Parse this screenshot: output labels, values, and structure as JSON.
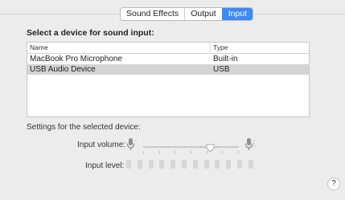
{
  "tabs": [
    {
      "label": "Sound Effects",
      "active": false
    },
    {
      "label": "Output",
      "active": false
    },
    {
      "label": "Input",
      "active": true
    }
  ],
  "section_title": "Select a device for sound input:",
  "table": {
    "columns": [
      "Name",
      "Type"
    ],
    "rows": [
      {
        "name": "MacBook Pro Microphone",
        "type": "Built-in",
        "selected": false
      },
      {
        "name": "USB Audio Device",
        "type": "USB",
        "selected": true
      }
    ]
  },
  "settings_label": "Settings for the selected device:",
  "input_volume": {
    "label": "Input volume:",
    "value_fraction": 0.72
  },
  "input_level": {
    "label": "Input level:",
    "bars": 12,
    "active_bars": 0
  },
  "help_label": "?",
  "colors": {
    "accent": "#3f8af1",
    "selected_row": "#d4d4d4",
    "level_bar": "#d6d6d6"
  },
  "icons": {
    "volume_low": "microphone-low-icon",
    "volume_high": "microphone-high-icon"
  }
}
